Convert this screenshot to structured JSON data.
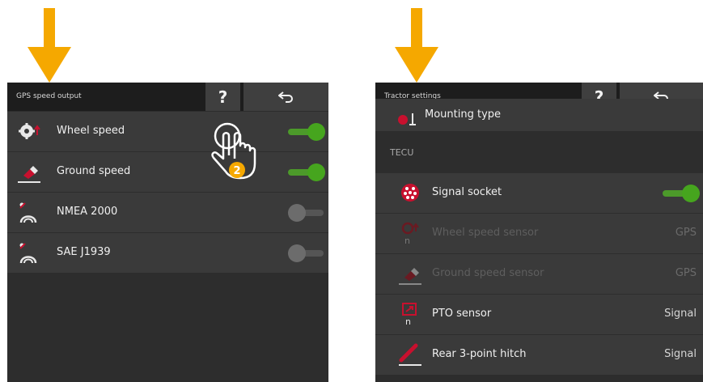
{
  "colors": {
    "arrow": "#f5a800",
    "toggle_on": "#46a51e",
    "accent_red": "#c8102e",
    "hand_badge": "#f5a800"
  },
  "left": {
    "title": "GPS speed output",
    "help_label": "?",
    "back_icon": "back-arrow-icon",
    "rows": [
      {
        "label": "Wheel speed",
        "icon": "wheel-sensor-icon",
        "toggle": true
      },
      {
        "label": "Ground speed",
        "icon": "radar-sensor-icon",
        "toggle": true
      },
      {
        "label": "NMEA 2000",
        "icon": "satellite-dish-icon",
        "toggle": false
      },
      {
        "label": "SAE J1939",
        "icon": "satellite-dish-icon",
        "toggle": false
      }
    ],
    "callout": {
      "icon": "pointing-hand-icon",
      "badge": "2"
    }
  },
  "right": {
    "title": "Tractor settings",
    "help_label": "?",
    "back_icon": "back-arrow-icon",
    "partial_row_label": "Mounting type",
    "section_label": "TECU",
    "rows": [
      {
        "label": "Signal socket",
        "icon": "signal-socket-icon",
        "toggle": true,
        "disabled": false
      },
      {
        "label": "Wheel speed sensor",
        "icon": "wheel-sensor-icon",
        "value": "GPS",
        "disabled": true
      },
      {
        "label": "Ground speed sensor",
        "icon": "radar-sensor-icon",
        "value": "GPS",
        "disabled": true
      },
      {
        "label": "PTO sensor",
        "icon": "pto-sensor-icon",
        "value": "Signal",
        "disabled": false
      },
      {
        "label": "Rear 3-point hitch",
        "icon": "rear-hitch-icon",
        "value": "Signal",
        "disabled": false
      }
    ]
  }
}
